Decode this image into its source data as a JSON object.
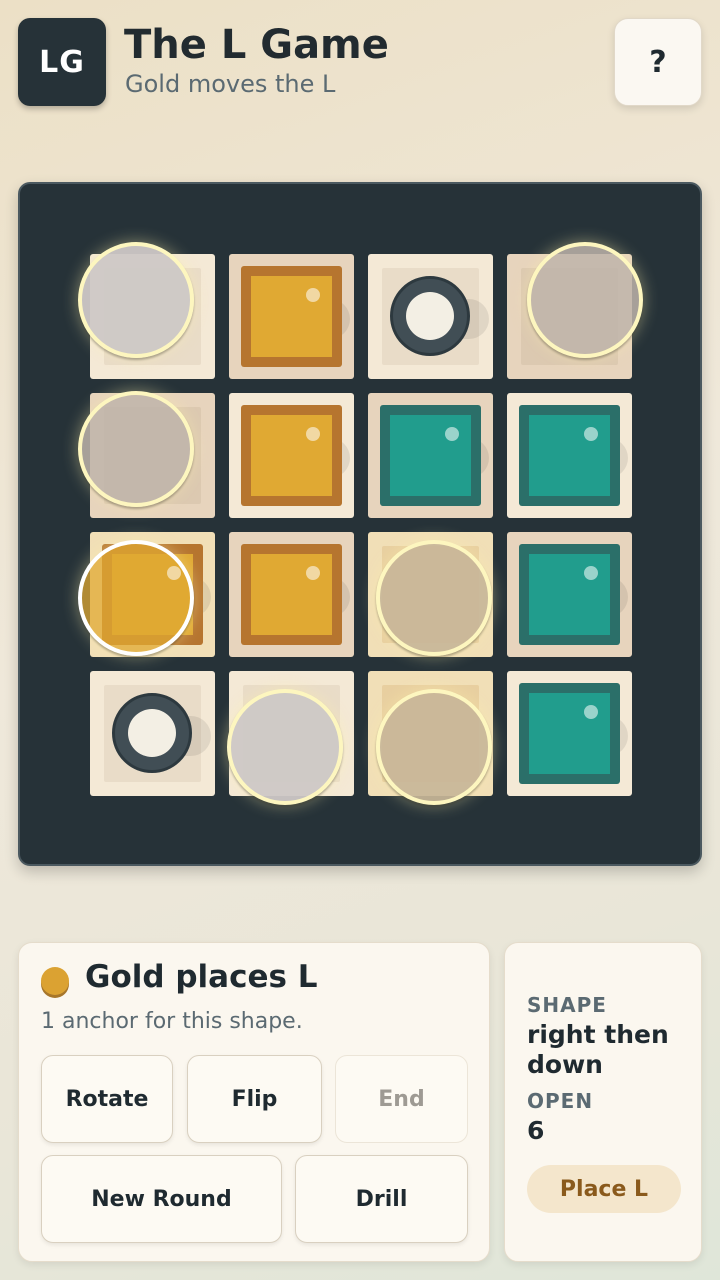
{
  "header": {
    "logo_text": "LG",
    "title": "The L Game",
    "subtitle": "Gold moves the L",
    "help_label": "?"
  },
  "board": {
    "rows": 4,
    "cols": 4,
    "cells": [
      [
        "empty",
        "gold",
        "neutral",
        "empty"
      ],
      [
        "empty",
        "gold",
        "teal",
        "teal"
      ],
      [
        "gold",
        "gold",
        "empty",
        "teal"
      ],
      [
        "neutral",
        "empty",
        "empty",
        "teal"
      ]
    ],
    "anchor_markers": [
      [
        0,
        0
      ],
      [
        0,
        3
      ],
      [
        1,
        0
      ],
      [
        2,
        0
      ],
      [
        2,
        2
      ],
      [
        3,
        1
      ],
      [
        3,
        2
      ]
    ],
    "colors": {
      "gold": "#e0a933",
      "teal": "#219d8d",
      "board": "#263238"
    }
  },
  "status": {
    "player_color": "#dba232",
    "title": "Gold places L",
    "hint": "1 anchor for this shape.",
    "buttons": {
      "rotate": "Rotate",
      "flip": "Flip",
      "end": "End",
      "new_round": "New Round",
      "drill": "Drill"
    }
  },
  "info": {
    "shape_label": "SHAPE",
    "shape_value": "right then down",
    "open_label": "OPEN",
    "open_value": "6",
    "place_label": "Place L"
  }
}
